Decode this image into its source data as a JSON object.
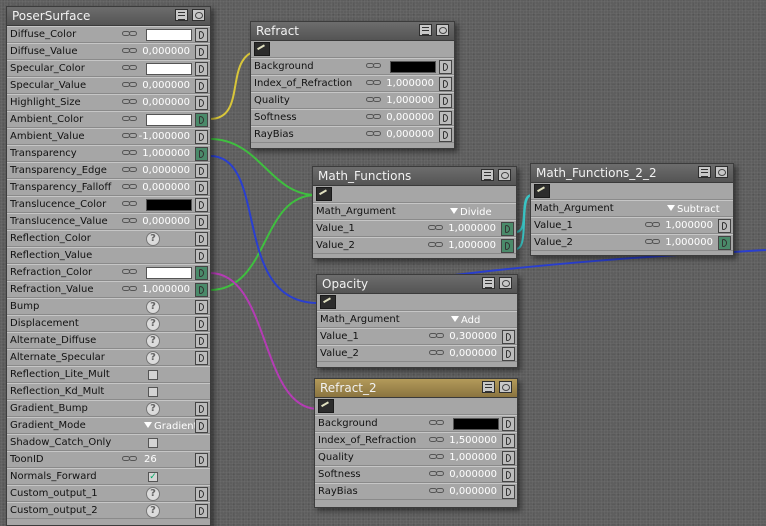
{
  "nodes": {
    "poser": {
      "title": "PoserSurface",
      "rows": [
        {
          "label": "Diffuse_Color",
          "kind": "color",
          "color": "white"
        },
        {
          "label": "Diffuse_Value",
          "kind": "value",
          "value": "0,000000"
        },
        {
          "label": "Specular_Color",
          "kind": "color",
          "color": "white"
        },
        {
          "label": "Specular_Value",
          "kind": "value",
          "value": "0,000000"
        },
        {
          "label": "Highlight_Size",
          "kind": "value",
          "value": "0,000000"
        },
        {
          "label": "Ambient_Color",
          "kind": "color",
          "color": "white",
          "connected": true
        },
        {
          "label": "Ambient_Value",
          "kind": "value",
          "value": "-1,000000"
        },
        {
          "label": "Transparency",
          "kind": "value",
          "value": "1,000000",
          "connected": true
        },
        {
          "label": "Transparency_Edge",
          "kind": "value",
          "value": "0,000000"
        },
        {
          "label": "Transparency_Falloff",
          "kind": "value",
          "value": "0,000000"
        },
        {
          "label": "Translucence_Color",
          "kind": "color",
          "color": "black"
        },
        {
          "label": "Translucence_Value",
          "kind": "value",
          "value": "0,000000"
        },
        {
          "label": "Reflection_Color",
          "kind": "q"
        },
        {
          "label": "Reflection_Value",
          "kind": "empty"
        },
        {
          "label": "Refraction_Color",
          "kind": "color",
          "color": "white",
          "connected": true
        },
        {
          "label": "Refraction_Value",
          "kind": "value",
          "value": "1,000000",
          "connected": true
        },
        {
          "label": "Bump",
          "kind": "q"
        },
        {
          "label": "Displacement",
          "kind": "q"
        },
        {
          "label": "Alternate_Diffuse",
          "kind": "q"
        },
        {
          "label": "Alternate_Specular",
          "kind": "q"
        },
        {
          "label": "Reflection_Lite_Mult",
          "kind": "check",
          "checked": false
        },
        {
          "label": "Reflection_Kd_Mult",
          "kind": "check",
          "checked": false
        },
        {
          "label": "Gradient_Bump",
          "kind": "q"
        },
        {
          "label": "Gradient_Mode",
          "kind": "dropdown",
          "value": "Gradient B"
        },
        {
          "label": "Shadow_Catch_Only",
          "kind": "check",
          "checked": false
        },
        {
          "label": "ToonID",
          "kind": "number",
          "value": "26"
        },
        {
          "label": "Normals_Forward",
          "kind": "check",
          "checked": true
        },
        {
          "label": "Custom_output_1",
          "kind": "q"
        },
        {
          "label": "Custom_output_2",
          "kind": "q"
        }
      ]
    },
    "refract": {
      "title": "Refract",
      "rows": [
        {
          "label": "Background",
          "kind": "color",
          "color": "black"
        },
        {
          "label": "Index_of_Refraction",
          "kind": "value",
          "value": "1,000000"
        },
        {
          "label": "Quality",
          "kind": "value",
          "value": "1,000000"
        },
        {
          "label": "Softness",
          "kind": "value",
          "value": "0,000000"
        },
        {
          "label": "RayBias",
          "kind": "value",
          "value": "0,000000"
        }
      ]
    },
    "math1": {
      "title": "Math_Functions",
      "rows": [
        {
          "label": "Math_Argument",
          "kind": "dropdown",
          "value": "Divide"
        },
        {
          "label": "Value_1",
          "kind": "value",
          "value": "1,000000",
          "connected": true
        },
        {
          "label": "Value_2",
          "kind": "value",
          "value": "1,000000",
          "connected": true
        }
      ]
    },
    "math2": {
      "title": "Math_Functions_2_2",
      "rows": [
        {
          "label": "Math_Argument",
          "kind": "dropdown",
          "value": "Subtract"
        },
        {
          "label": "Value_1",
          "kind": "value",
          "value": "1,000000"
        },
        {
          "label": "Value_2",
          "kind": "value",
          "value": "1,000000",
          "connected": true
        }
      ]
    },
    "opacity": {
      "title": "Opacity",
      "rows": [
        {
          "label": "Math_Argument",
          "kind": "dropdown",
          "value": "Add"
        },
        {
          "label": "Value_1",
          "kind": "value",
          "value": "0,300000"
        },
        {
          "label": "Value_2",
          "kind": "value",
          "value": "0,000000"
        }
      ]
    },
    "refract2": {
      "title": "Refract_2",
      "rows": [
        {
          "label": "Background",
          "kind": "color",
          "color": "black"
        },
        {
          "label": "Index_of_Refraction",
          "kind": "value",
          "value": "1,500000"
        },
        {
          "label": "Quality",
          "kind": "value",
          "value": "1,000000"
        },
        {
          "label": "Softness",
          "kind": "value",
          "value": "0,000000"
        },
        {
          "label": "RayBias",
          "kind": "value",
          "value": "0,000000"
        }
      ]
    }
  },
  "wire_colors": {
    "yellow": "#d8c63a",
    "green": "#3fbf3f",
    "blue": "#2a3fd0",
    "magenta": "#b43cb4",
    "cyan": "#3ac6c6"
  }
}
